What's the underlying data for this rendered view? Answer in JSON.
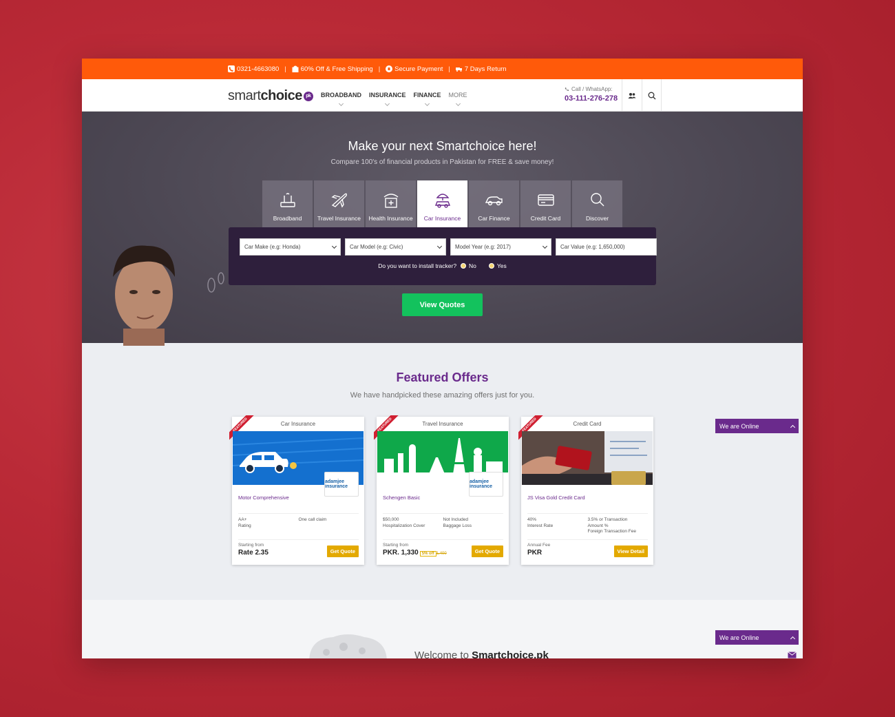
{
  "promo": {
    "phone": "0321-4663080",
    "offer": "60% Off & Free Shipping",
    "payment": "Secure Payment",
    "returns": "7 Days Return"
  },
  "header": {
    "logo_light": "smart",
    "logo_bold": "choice",
    "logo_badge": "pk",
    "nav": [
      "BROADBAND",
      "INSURANCE",
      "FINANCE",
      "MORE"
    ],
    "contact_label": "Call / WhatsApp:",
    "contact_number": "03-111-276-278"
  },
  "hero": {
    "title": "Make your next Smartchoice here!",
    "subtitle": "Compare 100's of financial products in Pakistan for FREE & save money!",
    "tabs": [
      {
        "label": "Broadband",
        "icon": "router-icon"
      },
      {
        "label": "Travel Insurance",
        "icon": "airplane-icon"
      },
      {
        "label": "Health Insurance",
        "icon": "medical-kit-icon"
      },
      {
        "label": "Car Insurance",
        "icon": "car-umbrella-icon",
        "active": true
      },
      {
        "label": "Car Finance",
        "icon": "car-icon"
      },
      {
        "label": "Credit Card",
        "icon": "credit-card-icon"
      },
      {
        "label": "Discover",
        "icon": "search-icon"
      }
    ],
    "fields": {
      "car_make": "Car Make (e.g: Honda)",
      "car_model": "Car Model (e.g: Civic)",
      "model_year": "Model Year (e.g: 2017)",
      "car_value": "Car Value (e.g: 1,650,000)"
    },
    "tracker_question": "Do you want to install tracker?",
    "tracker_no": "No",
    "tracker_yes": "Yes",
    "cta": "View Quotes"
  },
  "featured": {
    "title": "Featured Offers",
    "subtitle": "We have handpicked these amazing offers just for you.",
    "ribbon": "FEATURED",
    "cards": [
      {
        "category": "Car Insurance",
        "partner": "adamjee insurance",
        "name": "Motor Comprehensive",
        "spec1_value": "AA+",
        "spec1_label": "Rating",
        "spec2_value": "One call claim",
        "spec2_label": "",
        "spec2_extra": "",
        "foot_label": "Starting from",
        "price": "Rate 2.35",
        "cta": "Get Quote"
      },
      {
        "category": "Travel Insurance",
        "partner": "adamjee insurance",
        "name": "Schengen Basic",
        "spec1_value": "$50,000",
        "spec1_label": "Hospitalization Cover",
        "spec2_value": "Not Included",
        "spec2_label": "Baggage Loss",
        "spec2_extra": "",
        "foot_label": "Starting from",
        "price": "PKR. 1,330",
        "discount": "5% off",
        "old_price": "1,400",
        "cta": "Get Quote"
      },
      {
        "category": "Credit Card",
        "partner": "",
        "name": "JS Visa Gold Credit Card",
        "spec1_value": "40%",
        "spec1_label": "Interest Rate",
        "spec2_value": "3.5% or Transaction",
        "spec2_label": "Amount %",
        "spec2_extra": "Foreign Transaction Fee",
        "foot_label": "Annual Fee",
        "price": "PKR",
        "cta": "View Detail"
      }
    ]
  },
  "chat": {
    "status": "We are Online"
  },
  "welcome": {
    "prefix": "Welcome to ",
    "brand": "Smartchoice.pk"
  },
  "colors": {
    "accent_orange": "#ff5a0a",
    "brand_purple": "#6a2a8c",
    "cta_green": "#13c25d",
    "cta_gold": "#e3a900"
  }
}
